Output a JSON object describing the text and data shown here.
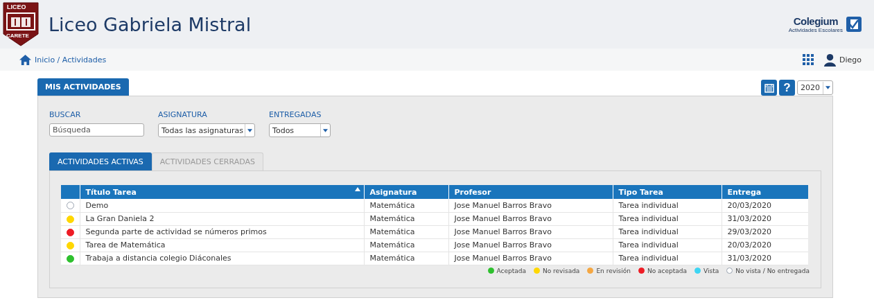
{
  "header": {
    "logo_top": "LICEO",
    "logo_bottom": "CARETE",
    "title": "Liceo Gabriela Mistral",
    "brand": "Colegium",
    "brand_sub": "Actividades Escolares"
  },
  "breadcrumb": "Inicio / Actividades",
  "user": "Diego",
  "main_tab": "MIS ACTIVIDADES",
  "help": "?",
  "year": "2020",
  "filters": [
    {
      "label": "BUSCAR",
      "kind": "text",
      "placeholder": "Búsqueda"
    },
    {
      "label": "ASIGNATURA",
      "kind": "select",
      "value": "Todas las asignaturas"
    },
    {
      "label": "ENTREGADAS",
      "kind": "select",
      "value": "Todos"
    }
  ],
  "tabs": [
    {
      "label": "ACTIVIDADES ACTIVAS",
      "selected": true
    },
    {
      "label": "ACTIVIDADES CERRADAS",
      "selected": false
    }
  ],
  "table": {
    "columns": [
      "Título Tarea",
      "Asignatura",
      "Profesor",
      "Tipo Tarea",
      "Entrega"
    ],
    "rows": [
      {
        "color": "#ffffff",
        "cells": [
          "Demo",
          "Matemática",
          "Jose Manuel Barros Bravo",
          "Tarea individual",
          "20/03/2020"
        ]
      },
      {
        "color": "#ffd700",
        "cells": [
          "La Gran Daniela 2",
          "Matemática",
          "Jose Manuel Barros Bravo",
          "Tarea individual",
          "31/03/2020"
        ]
      },
      {
        "color": "#ee1c25",
        "cells": [
          "Segunda parte de actividad se números primos",
          "Matemática",
          "Jose Manuel Barros Bravo",
          "Tarea individual",
          "29/03/2020"
        ]
      },
      {
        "color": "#ffd700",
        "cells": [
          "Tarea de Matemática",
          "Matemática",
          "Jose Manuel Barros Bravo",
          "Tarea individual",
          "20/03/2020"
        ]
      },
      {
        "color": "#2ec02e",
        "cells": [
          "Trabaja a distancia colegio Diáconales",
          "Matemática",
          "Jose Manuel Barros Bravo",
          "Tarea individual",
          "31/03/2020"
        ]
      }
    ]
  },
  "legend": [
    {
      "label": "Aceptada",
      "color": "#2ec02e"
    },
    {
      "label": "No revisada",
      "color": "#ffd700"
    },
    {
      "label": "En revisión",
      "color": "#f5a742"
    },
    {
      "label": "No aceptada",
      "color": "#ee1c25"
    },
    {
      "label": "Vista",
      "color": "#3dd5f3"
    },
    {
      "label": "No vista / No entregada",
      "color": "#ffffff"
    }
  ]
}
